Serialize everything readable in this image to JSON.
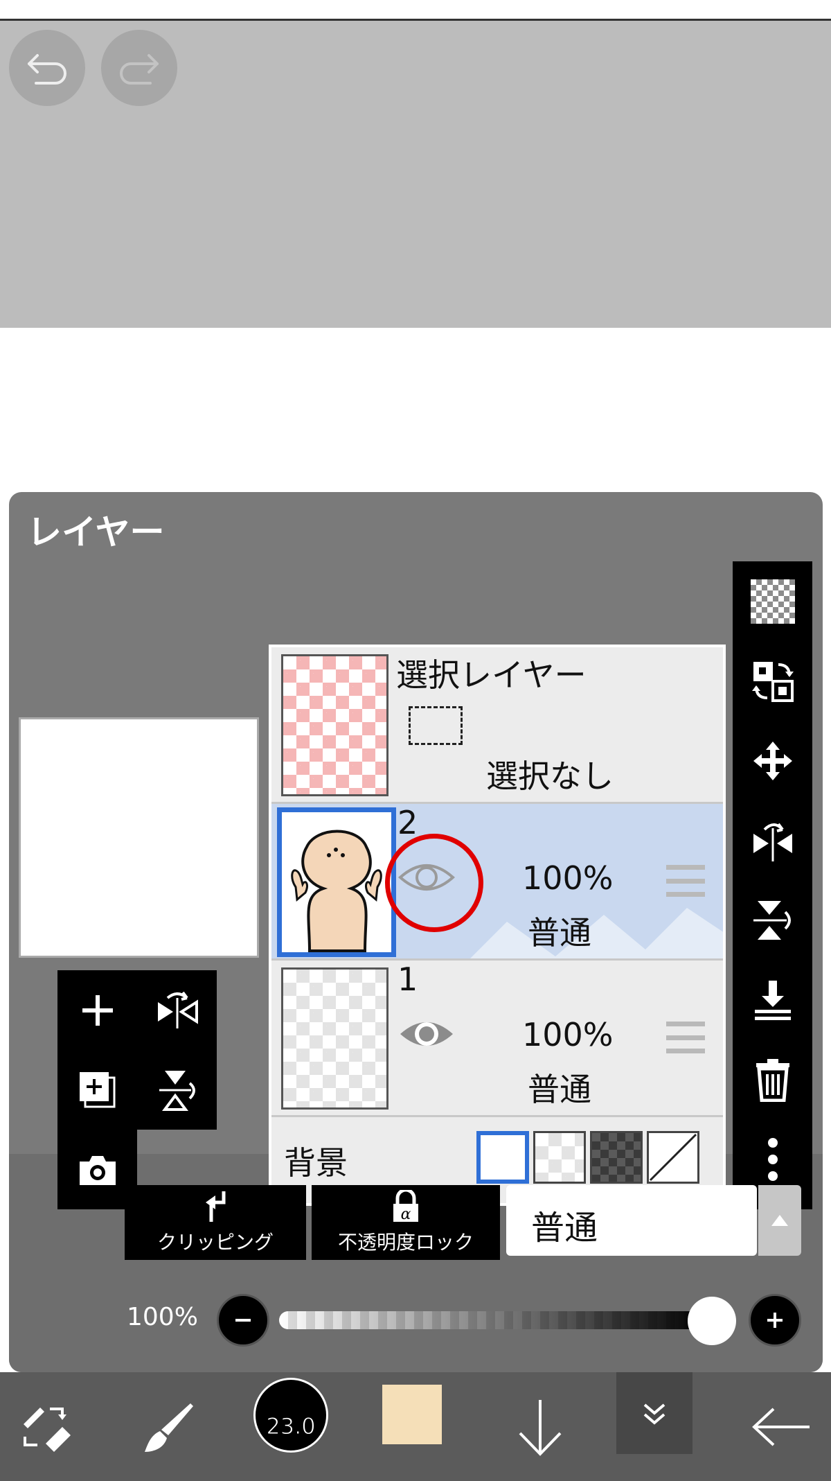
{
  "canvas": {
    "undo_icon": "undo-icon",
    "redo_icon": "redo-icon"
  },
  "layer_panel": {
    "title": "レイヤー",
    "layers": [
      {
        "name": "選択レイヤー",
        "status": "選択なし",
        "thumbnail": "pink-checker"
      },
      {
        "number": "2",
        "opacity": "100%",
        "blend": "普通",
        "visible": true,
        "selected": true,
        "thumbnail": "character-drawing"
      },
      {
        "number": "1",
        "opacity": "100%",
        "blend": "普通",
        "visible": true,
        "selected": false,
        "thumbnail": "transparent"
      }
    ],
    "background": {
      "label": "背景",
      "options": [
        "white",
        "transparent",
        "dark-checker",
        "none"
      ],
      "selected": "white"
    },
    "clipping_label": "クリッピング",
    "alpha_lock_label": "不透明度ロック",
    "blend_mode": "普通",
    "opacity_label": "100%",
    "opacity_value": 1.0
  },
  "toolbar": {
    "brush_size": "23.0",
    "current_color": "#f5dfb8"
  },
  "colors": {
    "selected_border": "#2f6fd6",
    "selected_row": "#c9d8ef",
    "annotation_red": "#e00000"
  }
}
